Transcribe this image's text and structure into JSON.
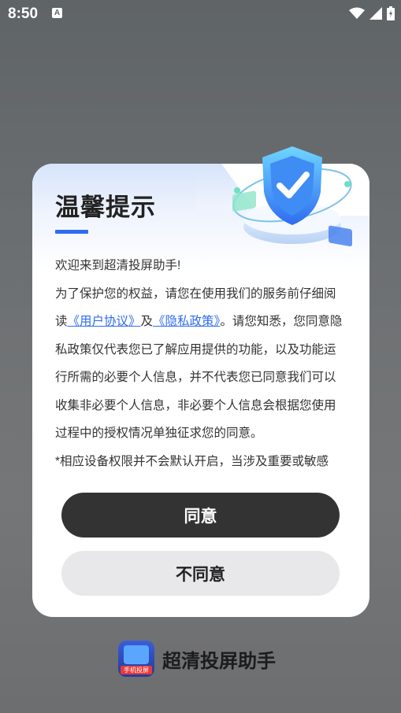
{
  "status_bar": {
    "time": "8:50",
    "notification_icon": "a-icon",
    "icons": [
      "wifi-icon",
      "signal-icon",
      "battery-charging-icon"
    ]
  },
  "dialog": {
    "title": "温馨提示",
    "welcome": "欢迎来到超清投屏助手!",
    "para1_a": "为了保护您的权益，请您在使用我们的服务前仔细阅读",
    "link_user_agreement": "《用户协议》",
    "and": "及",
    "link_privacy_policy": "《隐私政策》",
    "para1_b": "。请您知悉，您同意隐私政策仅代表您已了解应用提供的功能，以及功能运行所需的必要个人信息，并不代表您已同意我们可以收集非必要个人信息，非必要个人信息会根据您使用过程中的授权情况单独征求您的同意。",
    "para2": "*相应设备权限并不会默认开启，当涉及重要或敏感",
    "agree_button": "同意",
    "disagree_button": "不同意",
    "illustration": "shield-check-icon"
  },
  "footer": {
    "app_name": "超清投屏助手",
    "app_icon_tag": "手机投屏"
  },
  "colors": {
    "accent": "#2f6cf0",
    "agree_bg": "#333333",
    "disagree_bg": "#e8e8ea"
  }
}
